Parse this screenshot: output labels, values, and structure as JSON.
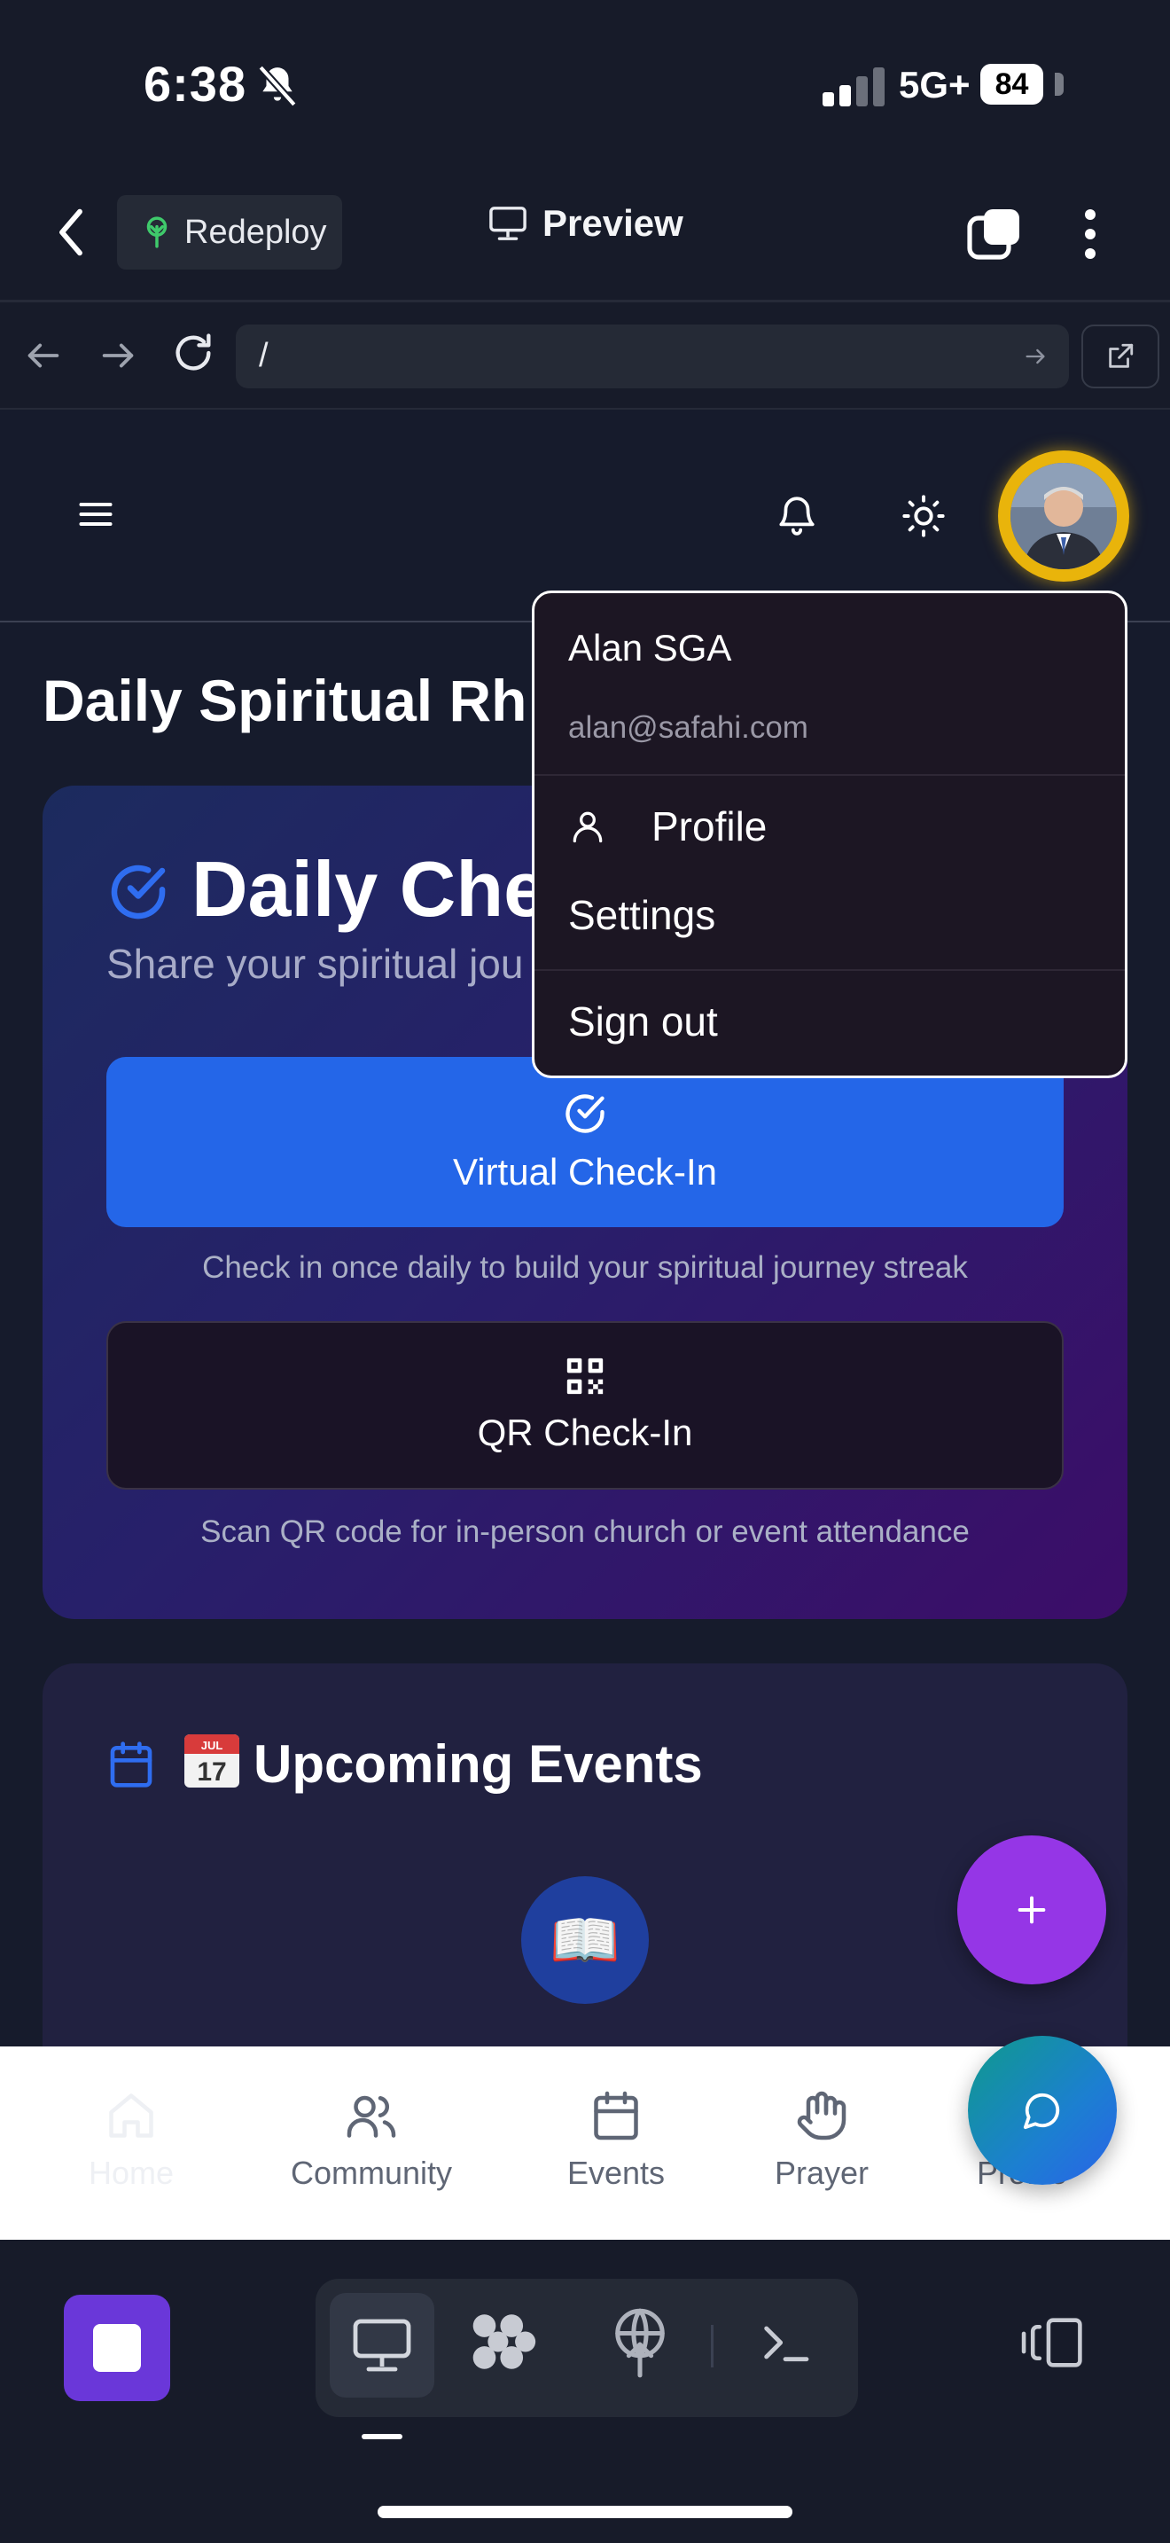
{
  "status_bar": {
    "time": "6:38",
    "network": "5G+",
    "battery": "84",
    "battery_level": 0.84
  },
  "replit_header": {
    "redeploy_label": "Redeploy",
    "preview_label": "Preview"
  },
  "url_bar": {
    "url": "/"
  },
  "page": {
    "heading": "Daily Spiritual Rh",
    "checkin": {
      "title": "Daily Chec",
      "subtitle": "Share your spiritual jou",
      "virtual_label": "Virtual Check-In",
      "virtual_hint": "Check in once daily to build your spiritual journey streak",
      "qr_label": "QR Check-In",
      "qr_hint": "Scan QR code for in-person church or event attendance"
    },
    "events": {
      "emoji_month": "JUL",
      "emoji_day": "17",
      "title": "Upcoming Events",
      "bible_emoji": "📖"
    }
  },
  "profile_menu": {
    "user_name": "Alan SGA",
    "user_email": "alan@safahi.com",
    "items": [
      "Profile",
      "Settings",
      "Sign out"
    ]
  },
  "bottom_nav": {
    "items": [
      {
        "label": "Home",
        "icon": "home-icon",
        "active": true
      },
      {
        "label": "Community",
        "icon": "users-icon"
      },
      {
        "label": "Events",
        "icon": "calendar-icon"
      },
      {
        "label": "Prayer",
        "icon": "hand-icon"
      },
      {
        "label": "Profile",
        "icon": "user-icon"
      }
    ]
  },
  "colors": {
    "accent_blue": "#2466e8",
    "fab_purple": "#9536e6",
    "avatar_ring": "#e9b40b",
    "stop_button": "#6a37d9",
    "background": "#161b2c"
  }
}
